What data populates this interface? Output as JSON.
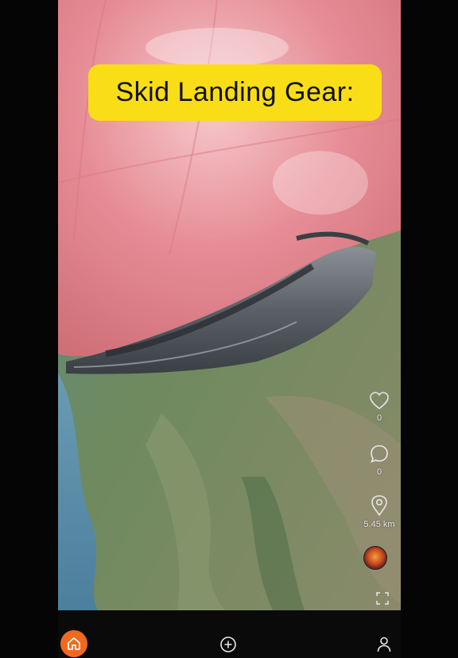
{
  "video": {
    "caption": "Skid Landing Gear:"
  },
  "actions": {
    "likes": {
      "icon": "heart-icon",
      "count": "0"
    },
    "comments": {
      "icon": "comment-bubble-icon",
      "count": "0"
    },
    "location": {
      "icon": "map-pin-icon",
      "distance": "5.45 km"
    },
    "avatar": {
      "icon": "user-avatar"
    },
    "fullscreen": {
      "icon": "fullscreen-icon"
    }
  },
  "nav": {
    "items": [
      {
        "id": "home",
        "icon": "home-icon",
        "active": true
      },
      {
        "id": "create",
        "icon": "plus-circle-icon",
        "active": false
      },
      {
        "id": "profile",
        "icon": "user-icon",
        "active": false
      }
    ]
  },
  "colors": {
    "accent": "#f06a1e",
    "caption_bg": "#f8dd17",
    "nav_bg": "#0a0a0a"
  }
}
